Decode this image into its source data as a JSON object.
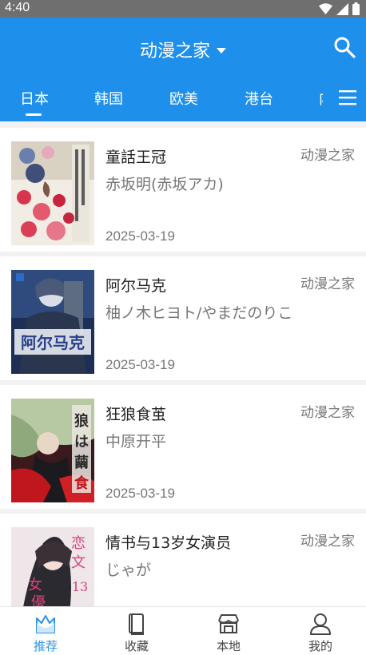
{
  "status_bar": {
    "time": "4:40"
  },
  "header": {
    "title": "动漫之家"
  },
  "tabs": [
    {
      "label": "日本",
      "active": true
    },
    {
      "label": "韩国",
      "active": false
    },
    {
      "label": "欧美",
      "active": false
    },
    {
      "label": "港台",
      "active": false
    },
    {
      "label": "内地",
      "active": false
    }
  ],
  "comics": [
    {
      "title": "童話王冠",
      "author": "赤坂明(赤坂アカ)",
      "date": "2025-03-19",
      "source": "动漫之家"
    },
    {
      "title": "阿尔马克",
      "author": "柚ノ木ヒヨト/やまだのりこ",
      "date": "2025-03-19",
      "source": "动漫之家"
    },
    {
      "title": "狂狼食茧",
      "author": "中原开平",
      "date": "2025-03-19",
      "source": "动漫之家"
    },
    {
      "title": "情书与13岁女演员",
      "author": "じゃが",
      "date": "",
      "source": "动漫之家"
    }
  ],
  "bottom_nav": [
    {
      "label": "推荐",
      "icon": "crown-icon",
      "active": true
    },
    {
      "label": "收藏",
      "icon": "book-icon",
      "active": false
    },
    {
      "label": "本地",
      "icon": "store-icon",
      "active": false
    },
    {
      "label": "我的",
      "icon": "user-icon",
      "active": false
    }
  ],
  "colors": {
    "primary": "#1e8fea",
    "active_nav": "#2a93e8",
    "list_bg": "#f2f2f2"
  }
}
